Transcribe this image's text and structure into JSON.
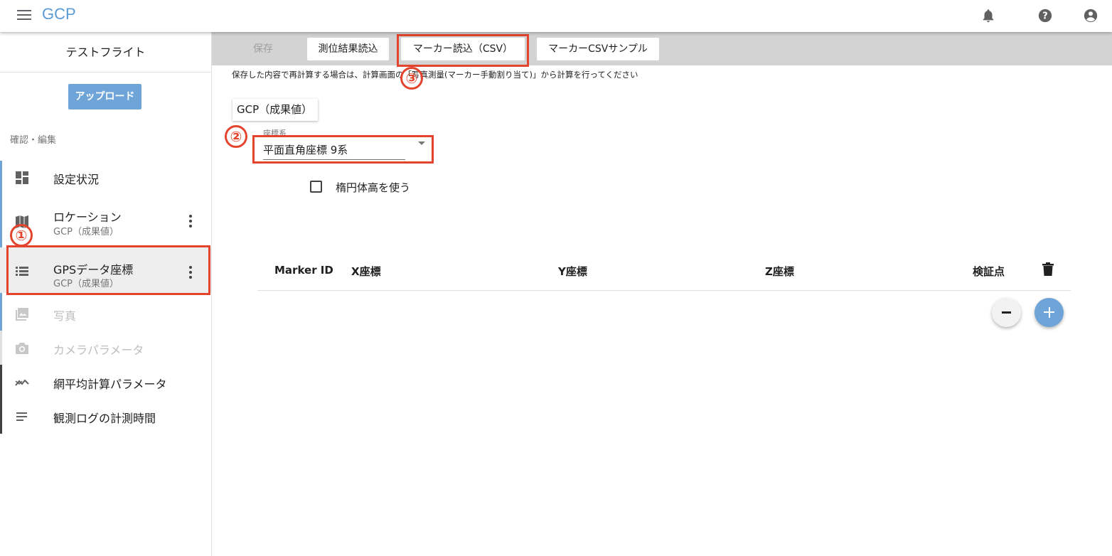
{
  "app": {
    "title": "GCP"
  },
  "sidebar": {
    "project_name": "テストフライト",
    "upload_label": "アップロード",
    "section_label": "確認・編集",
    "items": [
      {
        "label": "設定状況",
        "icon": "dashboard-icon"
      },
      {
        "label": "ロケーション",
        "sub": "GCP（成果値）",
        "icon": "map-icon"
      },
      {
        "label": "GPSデータ座標",
        "sub": "GCP（成果値）",
        "icon": "list-icon",
        "selected": true
      },
      {
        "label": "写真",
        "icon": "photo-icon",
        "disabled": true
      },
      {
        "label": "カメラパラメータ",
        "icon": "camera-icon",
        "disabled": true
      },
      {
        "label": "網平均計算パラメータ",
        "icon": "trend-icon"
      },
      {
        "label": "観測ログの計測時間",
        "icon": "notes-icon"
      }
    ]
  },
  "toolbar": {
    "save_label": "保存",
    "import_results_label": "測位結果読込",
    "import_markers_label": "マーカー読込（CSV）",
    "sample_label": "マーカーCSVサンプル"
  },
  "notice": "保存した内容で再計算する場合は、計算画面の「写真測量(マーカー手動割り当て)」から計算を行ってください",
  "main": {
    "tab_label": "GCP（成果値）",
    "coord_system": {
      "label": "座標系",
      "value": "平面直角座標 9系"
    },
    "ellipsoid_checkbox": {
      "label": "楕円体高を使う",
      "checked": false
    },
    "table_headers": [
      "Marker ID",
      "X座標",
      "Y座標",
      "Z座標",
      "検証点"
    ]
  },
  "annotations": [
    "①",
    "②",
    "③"
  ],
  "colors": {
    "accent": "#6ea4d7",
    "annotation": "#e4442d",
    "toolbar_bg": "#d3d3d3"
  }
}
